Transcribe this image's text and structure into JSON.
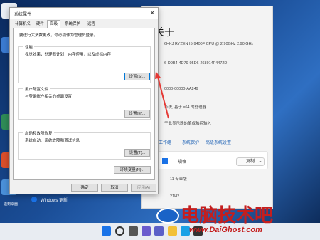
{
  "dialog": {
    "title": "系统属性",
    "tabs": [
      "计算机名",
      "硬件",
      "高级",
      "系统保护",
      "远程"
    ],
    "active_tab": 2,
    "note": "要进行大多数更改，你必须作为管理员登录。",
    "performance": {
      "label": "性能",
      "desc": "视觉效果，处理器计划，内存使用，以及虚拟内存",
      "button": "设置(S)..."
    },
    "profiles": {
      "label": "用户配置文件",
      "desc": "与登录帐户相关的桌面设置",
      "button": "设置(E)..."
    },
    "startup": {
      "label": "启动和故障恢复",
      "desc": "系统启动、系统故障和调试信息",
      "button": "设置(T)..."
    },
    "env_button": "环境变量(N)...",
    "ok": "确定",
    "cancel": "取消",
    "apply": "应用(A)"
  },
  "settings": {
    "title_fragment": "关于",
    "specs": [
      "6HKJ RYZEN I5-9400F CPU @ 2.90GHz   2.90 GHz",
      "6-D9B4-4D79-95D6-268914F4472D",
      "0000-00000-AA249",
      "系统, 基于 x64 的处理器",
      "于此显示器的笔或触控输入"
    ],
    "links": [
      "工作组",
      "系统保护",
      "高级系统设置"
    ],
    "section": "规格",
    "copy": "复制",
    "edition": "11 专业版",
    "version": "21H2",
    "windows_update": "Windows 更新"
  },
  "desktop": {
    "labels": [
      "",
      "",
      "",
      "送到桌面"
    ]
  },
  "watermark": {
    "text": "电脑技术吧",
    "url": "www.DaiGhost.com"
  }
}
